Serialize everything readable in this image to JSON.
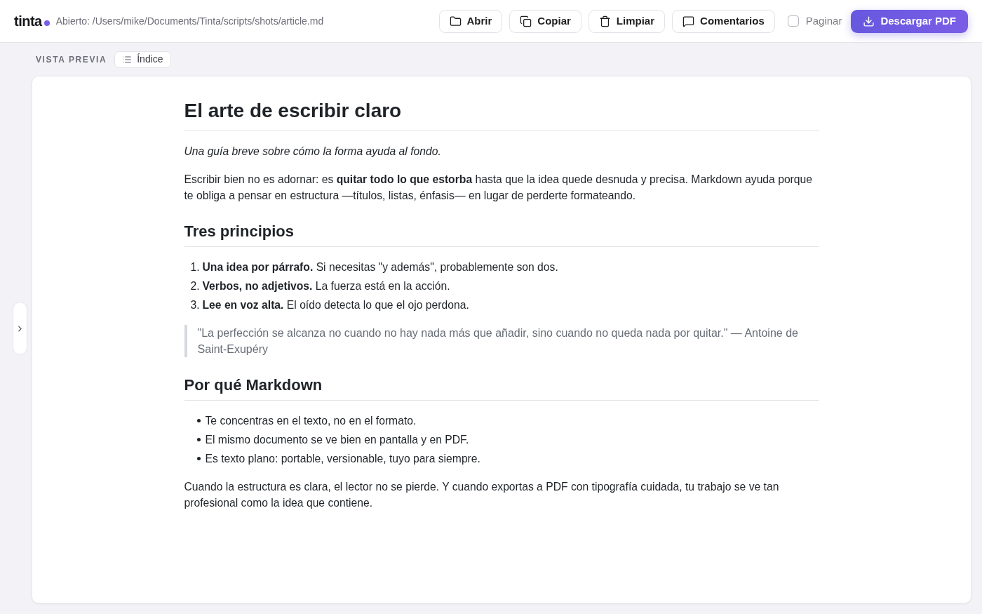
{
  "header": {
    "logo": "tinta",
    "status": "Abierto: /Users/mike/Documents/Tinta/scripts/shots/article.md"
  },
  "toolbar": {
    "buttons": [
      {
        "label": "Abrir"
      },
      {
        "label": "Copiar"
      },
      {
        "label": "Limpiar"
      },
      {
        "label": "Comentarios"
      }
    ],
    "paginate": {
      "label": "Paginar",
      "checked": false
    },
    "download": {
      "label": "Descargar PDF"
    }
  },
  "preview": {
    "label": "VISTA PREVIA",
    "toc_button": "Índice"
  },
  "document": {
    "blocks": [
      {
        "kind": "title",
        "text": "El arte de escribir claro"
      },
      {
        "kind": "lead",
        "text": "Una guía breve sobre cómo la forma ayuda al fondo."
      },
      {
        "kind": "paragraph",
        "text": "Escribir bien no es adornar: es **quitar todo lo que estorba** hasta que la idea quede desnuda y precisa. Markdown ayuda porque te obliga a pensar en estructura —títulos, listas, énfasis— en lugar de perderte formateando."
      },
      {
        "kind": "heading",
        "text": "Tres principios"
      },
      {
        "kind": "ordered_list",
        "items": [
          {
            "number": "1.",
            "text": "**Una idea por párrafo.** Si necesitas \"y además\", probablemente son dos."
          },
          {
            "number": "2.",
            "text": "**Verbos, no adjetivos.** La fuerza está en la acción."
          },
          {
            "number": "3.",
            "text": "**Lee en voz alta.** El oído detecta lo que el ojo perdona."
          }
        ]
      },
      {
        "kind": "quote",
        "text": "\"La perfección se alcanza no cuando no hay nada más que añadir, sino cuando no queda nada por quitar.\" — Antoine de Saint-Exupéry"
      },
      {
        "kind": "heading",
        "text": "Por qué Markdown"
      },
      {
        "kind": "bullet_list",
        "items": [
          {
            "text": "Te concentras en el texto, no en el formato."
          },
          {
            "text": "El mismo documento se ve bien en pantalla y en PDF."
          },
          {
            "text": "Es texto plano: portable, versionable, tuyo para siempre."
          }
        ]
      },
      {
        "kind": "paragraph",
        "text": "Cuando la estructura es clara, el lector no se pierde. Y cuando exportas a PDF con tipografía cuidada, tu trabajo se ve tan profesional como la idea que contiene."
      }
    ]
  }
}
